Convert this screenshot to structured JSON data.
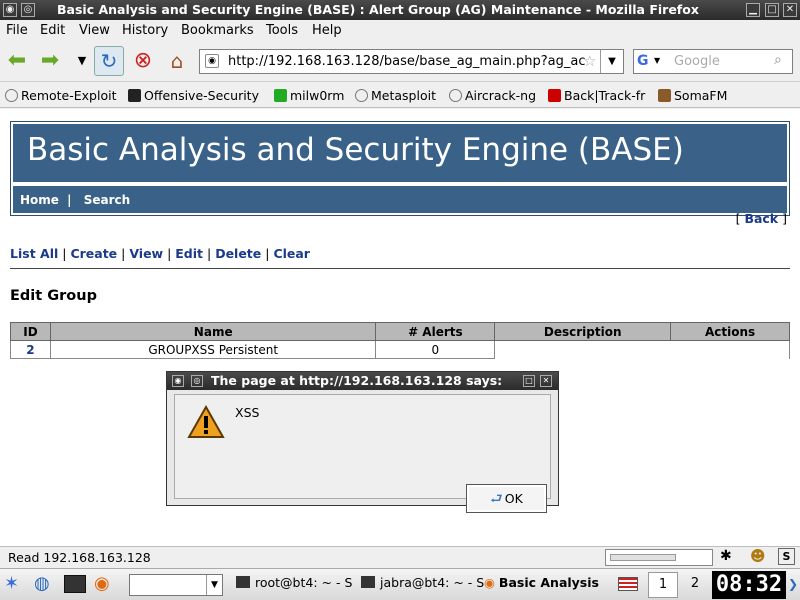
{
  "window": {
    "title": "Basic Analysis and Security Engine (BASE) : Alert Group (AG) Maintenance - Mozilla Firefox"
  },
  "menu": [
    "File",
    "Edit",
    "View",
    "History",
    "Bookmarks",
    "Tools",
    "Help"
  ],
  "navbar": {
    "url": "http://192.168.163.128/base/base_ag_main.php?ag_ac",
    "search_placeholder": "Google"
  },
  "bookmarks": [
    {
      "label": "Remote-Exploit",
      "icon": "globe-icon",
      "color": "#777777"
    },
    {
      "label": "Offensive-Security",
      "icon": "os-logo-icon",
      "color": "#222222"
    },
    {
      "label": "milw0rm",
      "icon": "matrix-icon",
      "color": "#22aa22"
    },
    {
      "label": "Metasploit",
      "icon": "globe-icon",
      "color": "#777777"
    },
    {
      "label": "Aircrack-ng",
      "icon": "globe-icon",
      "color": "#777777"
    },
    {
      "label": "Back|Track-fr",
      "icon": "backtrack-icon",
      "color": "#cc0000"
    },
    {
      "label": "SomaFM",
      "icon": "somafm-icon",
      "color": "#8a5a2a"
    }
  ],
  "page": {
    "banner_title": "Basic Analysis and Security Engine (BASE)",
    "nav_home": "Home",
    "nav_sep": "|",
    "nav_search": "Search",
    "back_open": "[",
    "back_label": "Back",
    "back_close": "]",
    "actions": [
      "List All",
      "Create",
      "View",
      "Edit",
      "Delete",
      "Clear"
    ],
    "section_title": "Edit Group",
    "table": {
      "headers": [
        "ID",
        "Name",
        "# Alerts",
        "Description",
        "Actions"
      ],
      "rows": [
        {
          "id": "2",
          "name": "GROUPXSS Persistent",
          "alerts": "0",
          "description": "",
          "actions": ""
        }
      ]
    }
  },
  "dialog": {
    "title": "The page at http://192.168.163.128 says:",
    "message": "XSS",
    "ok_label": "OK"
  },
  "status": {
    "text": "Read 192.168.163.128"
  },
  "taskbar": {
    "tasks": [
      "root@bt4: ~ - S",
      "jabra@bt4: ~ - S",
      "Basic Analysis"
    ],
    "desktops": [
      "1",
      "2"
    ],
    "clock": "08:32"
  },
  "colors": {
    "banner": "#3a6288",
    "link": "#1a3a8a",
    "table_header": "#b8b8b8"
  }
}
